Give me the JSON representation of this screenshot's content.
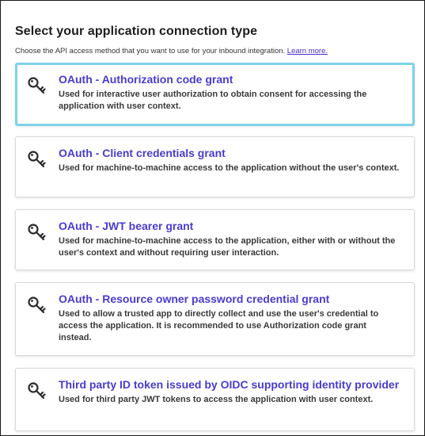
{
  "page": {
    "heading": "Select your application connection type",
    "subtitle": "Choose the API access method that you want to use for your inbound integration.",
    "learn_more": "Learn more."
  },
  "options": [
    {
      "title": "OAuth - Authorization code grant",
      "description": "Used for interactive user authorization to obtain consent for accessing the application with user context.",
      "selected": true,
      "icon": "key-icon"
    },
    {
      "title": "OAuth - Client credentials grant",
      "description": "Used for machine-to-machine access to the application without the user's context.",
      "selected": false,
      "icon": "key-icon"
    },
    {
      "title": "OAuth - JWT bearer grant",
      "description": "Used for machine-to-machine access to the application, either with or without the user's context and without requiring user interaction.",
      "selected": false,
      "icon": "key-icon"
    },
    {
      "title": "OAuth - Resource owner password credential grant",
      "description": "Used to allow a trusted app to directly collect and use the user's credential to access the application. It is recommended to use Authorization code grant instead.",
      "selected": false,
      "icon": "key-icon"
    },
    {
      "title": "Third party ID token issued by OIDC supporting identity provider",
      "description": "Used for third party JWT tokens to access the application with user context.",
      "selected": false,
      "icon": "key-icon"
    }
  ],
  "colors": {
    "title_link": "#4a3bd0",
    "selected_border": "#7dd3e8",
    "learn_more_link": "#4a2fc9"
  }
}
